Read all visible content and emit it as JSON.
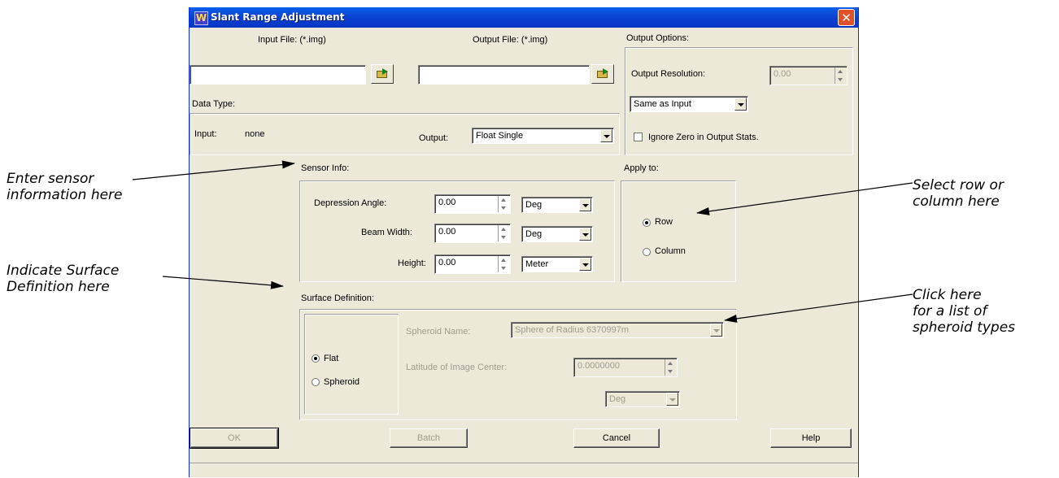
{
  "annotations": {
    "sensor": "Enter sensor\ninformation here",
    "surface": "Indicate Surface\nDefinition here",
    "row": "Select row or\ncolumn here",
    "spheroid": "Click here\nfor a list of\nspheroid types"
  },
  "window": {
    "title": "Slant Range Adjustment"
  },
  "files": {
    "input_label": "Input File: (*.img)",
    "input_value": "",
    "output_label": "Output File: (*.img)",
    "output_value": ""
  },
  "data_type": {
    "label": "Data Type:",
    "input_label": "Input:",
    "input_value": "none",
    "output_label": "Output:",
    "output_value": "Float Single"
  },
  "output_options": {
    "label": "Output Options:",
    "resolution_label": "Output Resolution:",
    "resolution_value": "0.00",
    "resolution_mode": "Same as Input",
    "ignore_zero_label": "Ignore Zero in Output Stats.",
    "ignore_zero_checked": false
  },
  "sensor_info": {
    "label": "Sensor Info:",
    "depression_label": "Depression Angle:",
    "depression_value": "0.00",
    "depression_unit": "Deg",
    "beam_label": "Beam Width:",
    "beam_value": "0.00",
    "beam_unit": "Deg",
    "height_label": "Height:",
    "height_value": "0.00",
    "height_unit": "Meter"
  },
  "apply_to": {
    "label": "Apply to:",
    "row_label": "Row",
    "column_label": "Column",
    "selected": "Row"
  },
  "surface": {
    "label": "Surface Definition:",
    "flat_label": "Flat",
    "spheroid_label": "Spheroid",
    "selected": "Flat",
    "spheroid_name_label": "Spheroid Name:",
    "spheroid_name_value": "Sphere of Radius 6370997m",
    "latitude_label": "Latitude of Image Center:",
    "latitude_value": "0.0000000",
    "latitude_unit": "Deg"
  },
  "buttons": {
    "ok": "OK",
    "batch": "Batch",
    "cancel": "Cancel",
    "help": "Help"
  }
}
